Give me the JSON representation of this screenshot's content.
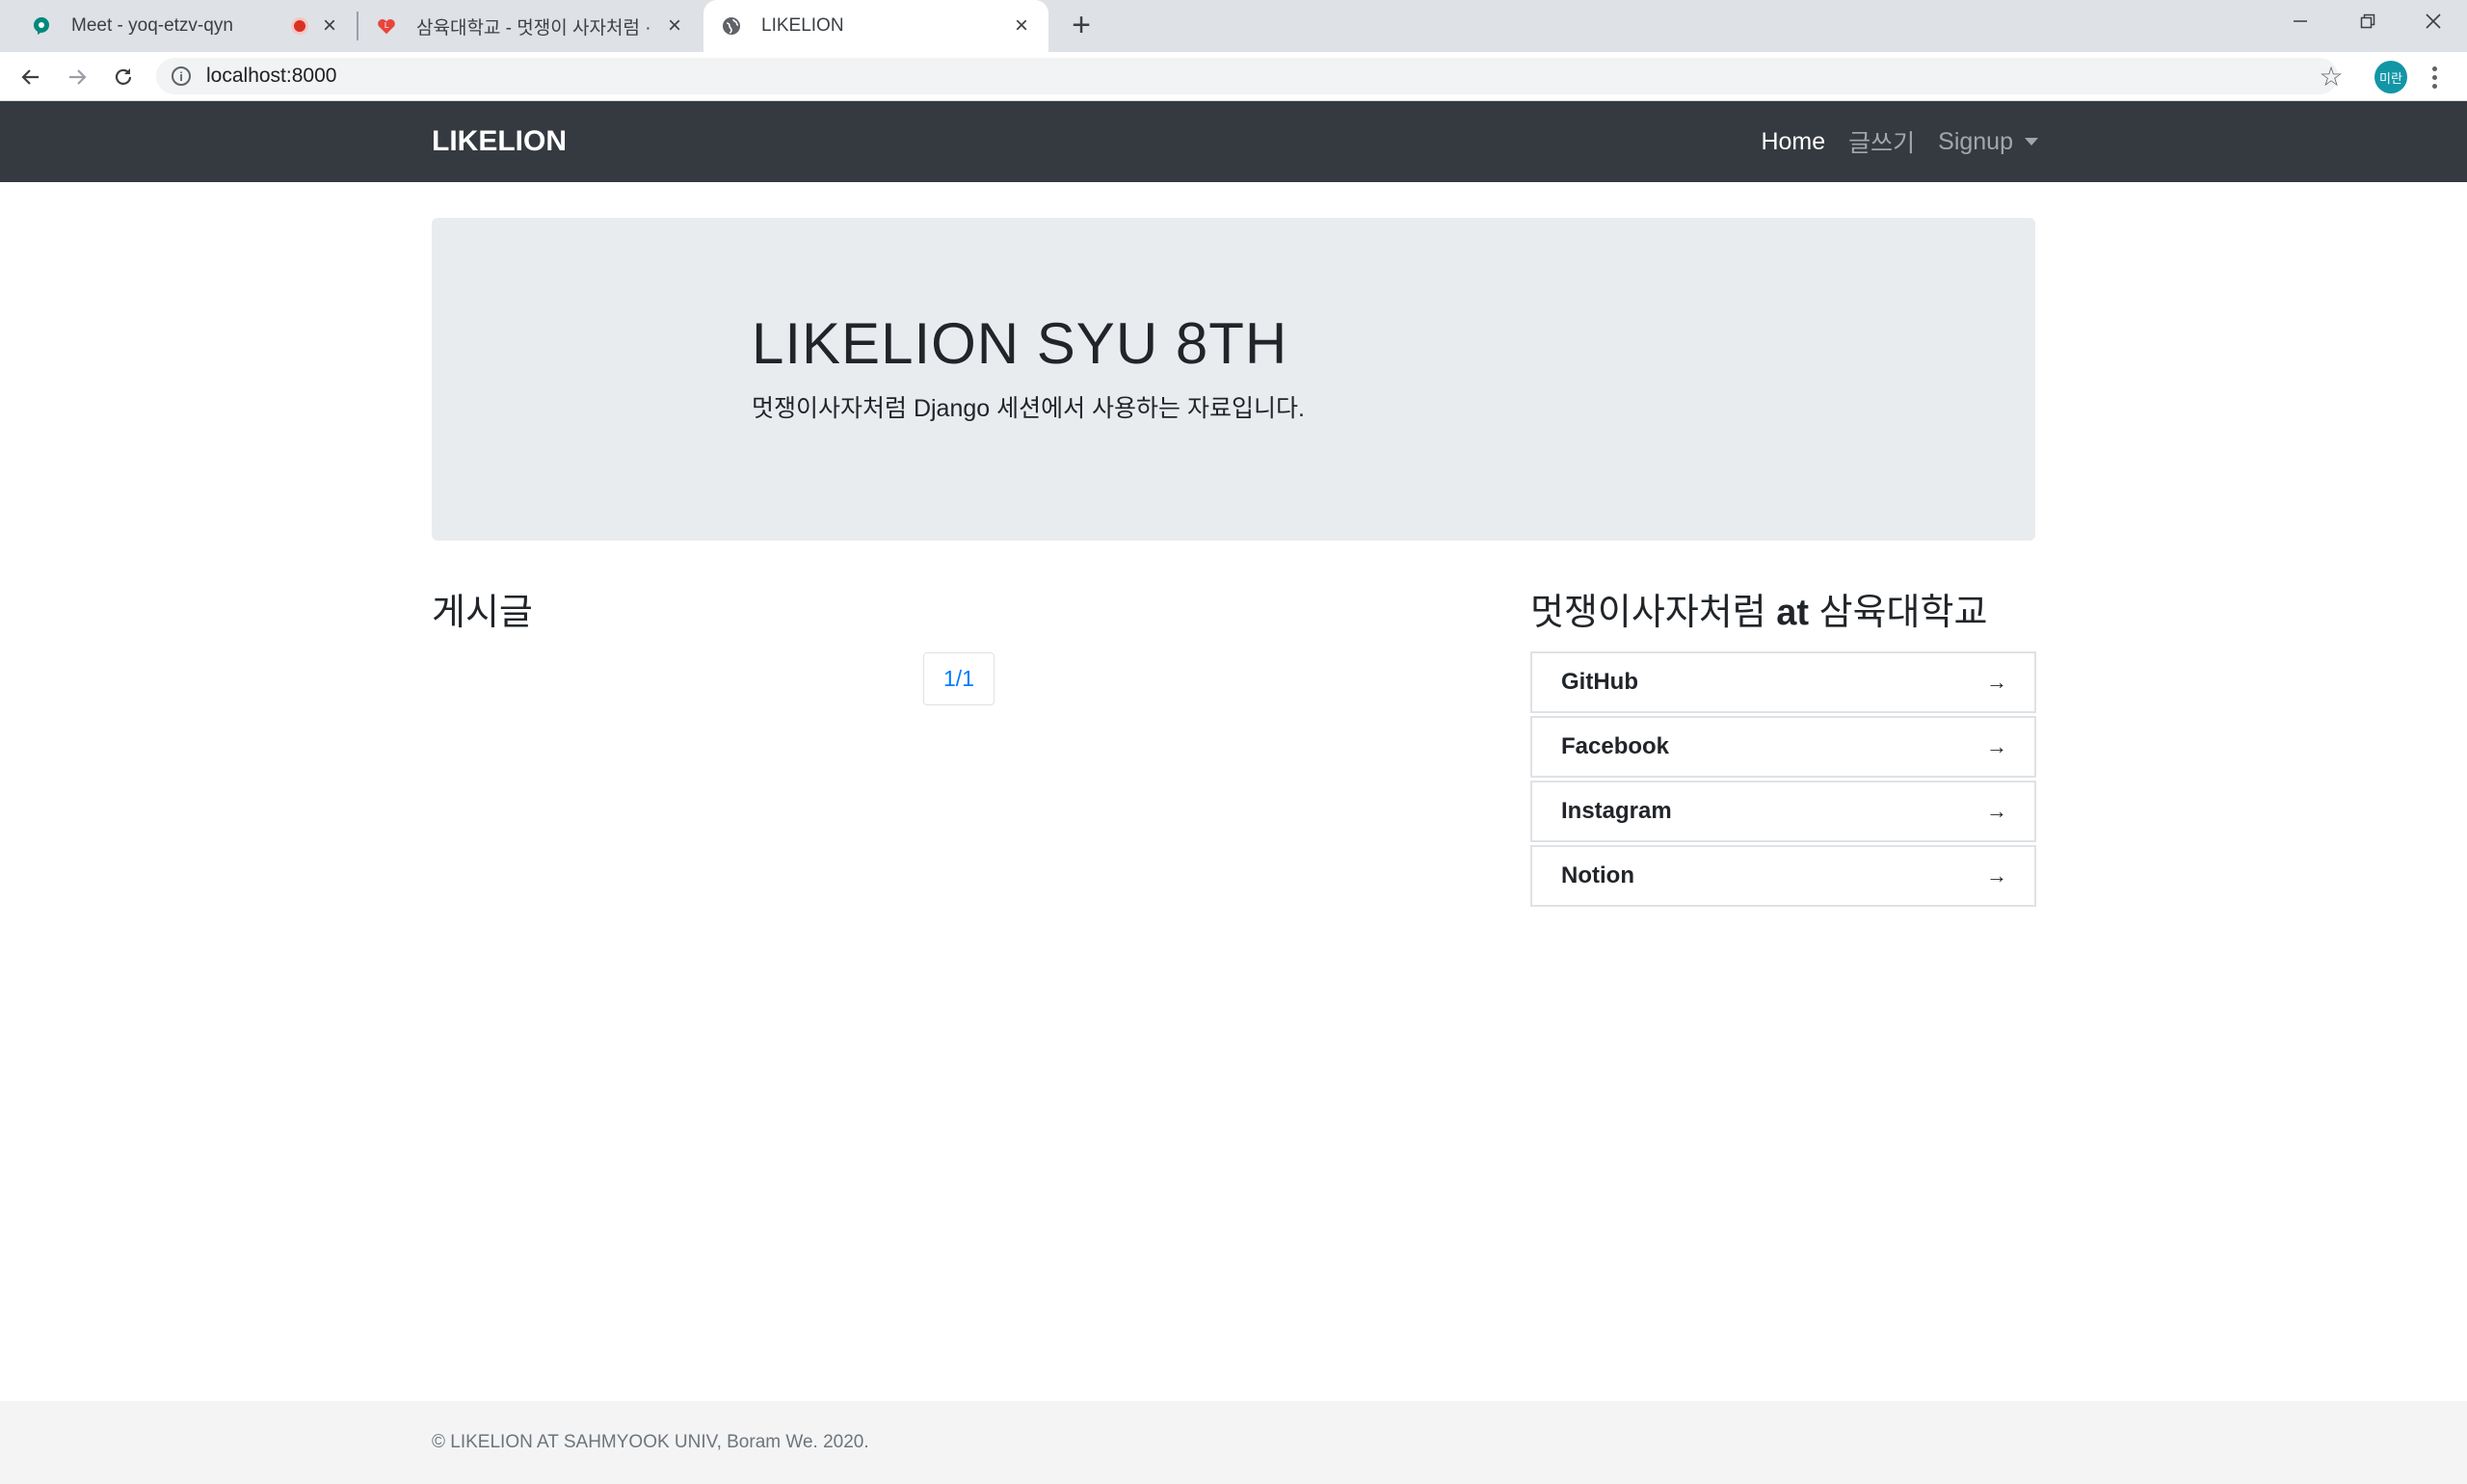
{
  "browser": {
    "tabs": [
      {
        "title": "Meet - yoq-etzv-qyn",
        "icon": "meet-icon",
        "recording": true
      },
      {
        "title": "삼육대학교 - 멋쟁이 사자처럼 ·",
        "icon": "likelion-heart-icon"
      },
      {
        "title": "LIKELION",
        "icon": "globe-icon",
        "active": true
      }
    ],
    "url": "localhost:8000",
    "profile_initials": "미란"
  },
  "navbar": {
    "brand": "LIKELION",
    "links": [
      {
        "label": "Home",
        "active": true
      },
      {
        "label": "글쓰기"
      },
      {
        "label": "Signup",
        "dropdown": true
      }
    ]
  },
  "jumbotron": {
    "title": "LIKELION SYU 8TH",
    "subtitle": "멋쟁이사자처럼 Django 세션에서 사용하는 자료입니다."
  },
  "posts": {
    "heading": "게시글",
    "pagination": "1/1"
  },
  "links_section": {
    "heading_prefix": "멋쟁이사자처럼 ",
    "heading_bold": "at",
    "heading_suffix": " 삼육대학교",
    "items": [
      {
        "label": "GitHub",
        "arrow": "→"
      },
      {
        "label": "Facebook",
        "arrow": "→"
      },
      {
        "label": "Instagram",
        "arrow": "→"
      },
      {
        "label": "Notion",
        "arrow": "→"
      }
    ]
  },
  "footer": {
    "copyright": "© LIKELION AT SAHMYOOK UNIV, Boram We. 2020."
  },
  "colors": {
    "navbar_bg": "#343a40",
    "jumbotron_bg": "#e9ecef",
    "link_blue": "#007bff",
    "footer_bg": "#f4f4f4"
  }
}
